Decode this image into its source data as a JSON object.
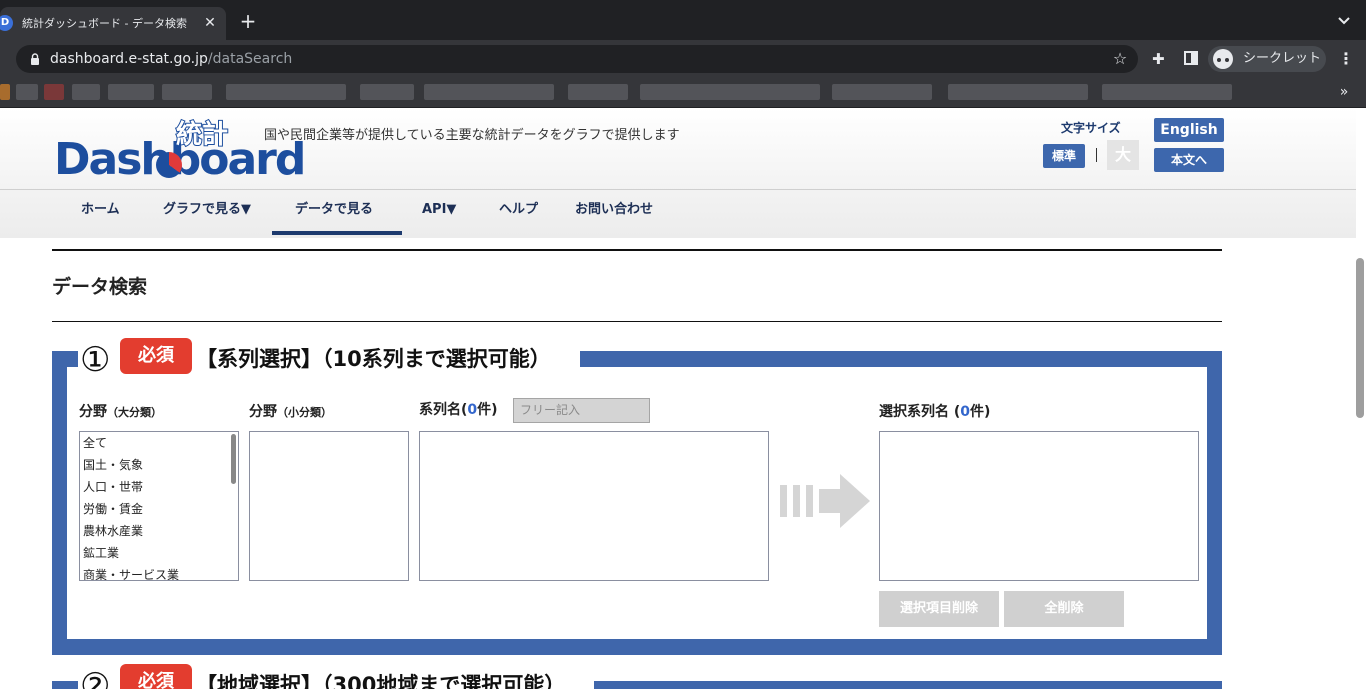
{
  "browser": {
    "tab_title": "統計ダッシュボード - データ検索",
    "tab_close": "✕",
    "new_tab": "+",
    "url_host": "dashboard.e-stat.go.jp",
    "url_path": "/dataSearch",
    "incognito_label": "シークレット",
    "bookmarks_more": "»",
    "icons": [
      "favicon-icon",
      "close-icon",
      "plus-icon",
      "chevron-down-icon",
      "lock-icon",
      "star-icon",
      "extension-icon",
      "side-panel-icon",
      "incognito-icon",
      "kebab-menu-icon"
    ]
  },
  "header": {
    "logo_text": "Dashboard",
    "logo_kanji": "統計",
    "tagline": "国や民間企業等が提供している主要な統計データをグラフで提供します",
    "font_size_label": "文字サイズ",
    "font_standard": "標準",
    "font_separator": "|",
    "font_large": "大",
    "english_button": "English",
    "skip_button": "本文へ"
  },
  "nav": {
    "items": [
      {
        "label": "ホーム"
      },
      {
        "label": "グラフで見る▼"
      },
      {
        "label": "データで見る",
        "active": true
      },
      {
        "label": "API▼"
      },
      {
        "label": "ヘルプ"
      },
      {
        "label": "お問い合わせ"
      }
    ]
  },
  "page": {
    "title": "データ検索"
  },
  "series_section": {
    "number": "①",
    "required_badge": "必須",
    "title": "【系列選択】（10系列まで選択可能）",
    "major_label": "分野",
    "major_sub": "（大分類）",
    "minor_label": "分野",
    "minor_sub": "（小分類）",
    "series_label_prefix": "系列名(",
    "series_count": "0",
    "series_label_suffix": "件)",
    "free_input_placeholder": "フリー記入",
    "selected_label_prefix": "選択系列名 (",
    "selected_count": "0",
    "selected_label_suffix": "件)",
    "major_options": [
      "全て",
      "国土・気象",
      "人口・世帯",
      "労働・賃金",
      "農林水産業",
      "鉱工業",
      "商業・サービス業"
    ],
    "delete_selected_button": "選択項目削除",
    "delete_all_button": "全削除"
  },
  "region_section": {
    "number": "②",
    "required_badge": "必須",
    "title": "【地域選択】（300地域まで選択可能）"
  },
  "colors": {
    "brand_blue": "#3f66ab",
    "nav_text": "#1d2f55",
    "required_red": "#e33d2f",
    "count_blue": "#3366cc"
  }
}
